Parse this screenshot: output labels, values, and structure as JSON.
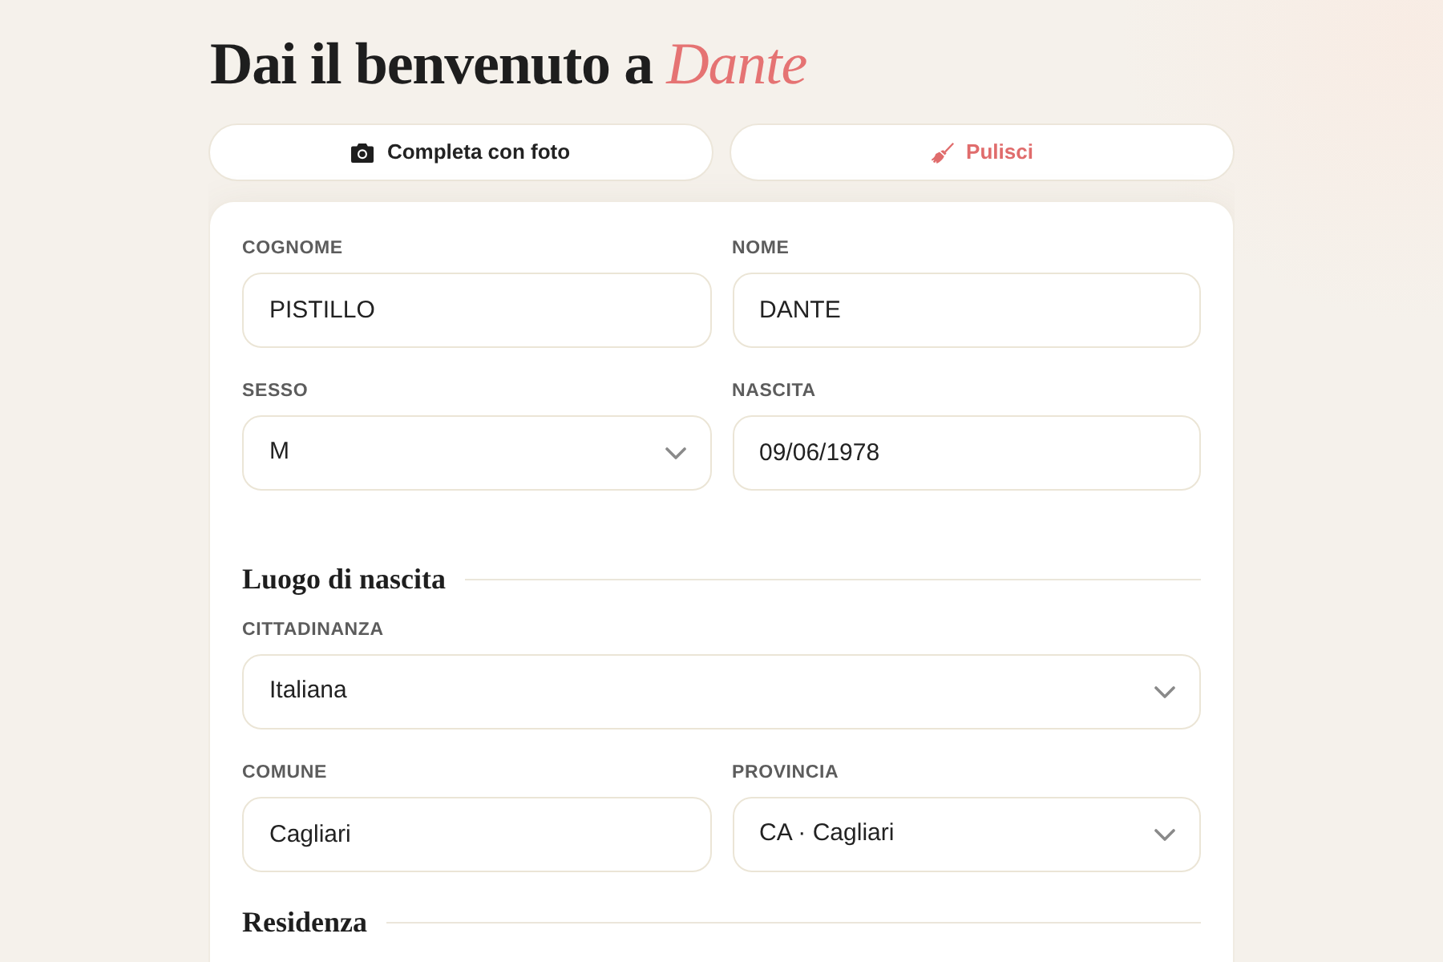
{
  "title": "Dai il benvenuto a *Dante*",
  "actions": [
    {
      "kind": "photo",
      "label": "Completa con foto"
    },
    {
      "kind": "clear",
      "label": "Pulisci"
    }
  ],
  "form": [
    {
      "kind": "row",
      "fields": [
        {
          "kind": "text",
          "label": "COGNOME",
          "value": "PISTILLO"
        },
        {
          "kind": "text",
          "label": "NOME",
          "value": "DANTE"
        }
      ]
    },
    {
      "kind": "row",
      "fields": [
        {
          "kind": "select",
          "label": "SESSO",
          "value": "M"
        },
        {
          "kind": "text",
          "label": "NASCITA",
          "value": "09/06/1978"
        }
      ]
    },
    {
      "kind": "heading",
      "text": "Luogo di nascita"
    },
    {
      "kind": "row",
      "fields": [
        {
          "kind": "select",
          "label": "CITTADINANZA",
          "value": "Italiana"
        }
      ]
    },
    {
      "kind": "row",
      "fields": [
        {
          "kind": "text",
          "label": "COMUNE",
          "value": "Cagliari"
        },
        {
          "kind": "select",
          "label": "PROVINCIA",
          "value": "CA · Cagliari"
        }
      ]
    },
    {
      "kind": "heading",
      "text": "Residenza"
    }
  ]
}
